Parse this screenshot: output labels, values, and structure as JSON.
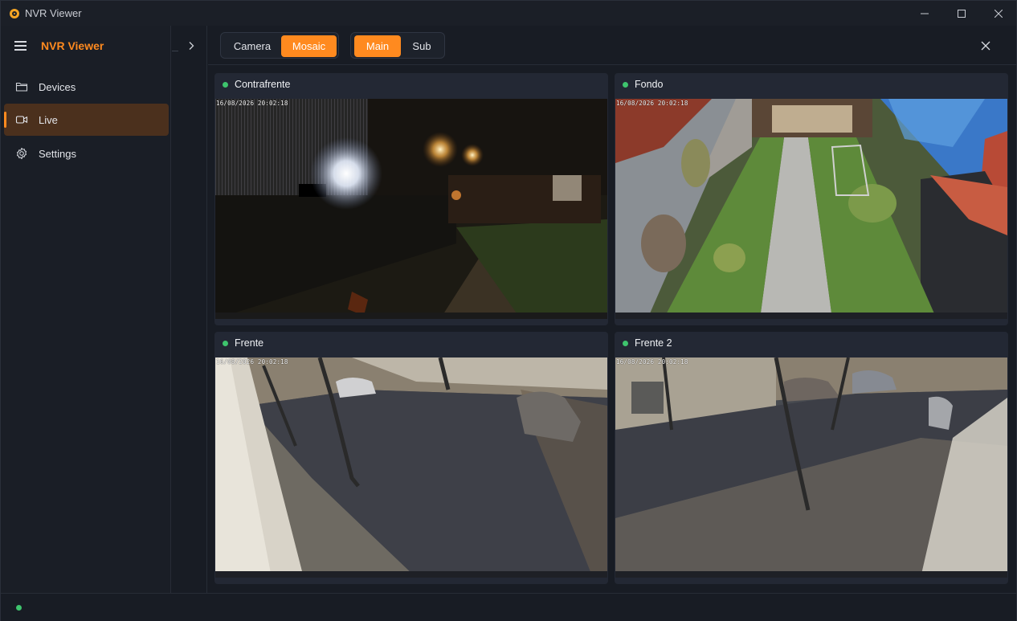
{
  "window": {
    "title": "NVR Viewer"
  },
  "sidebar": {
    "brand": "NVR Viewer",
    "items": [
      {
        "label": "Devices",
        "icon": "folder-icon",
        "active": false
      },
      {
        "label": "Live",
        "icon": "video-camera-icon",
        "active": true
      },
      {
        "label": "Settings",
        "icon": "gear-icon",
        "active": false
      }
    ]
  },
  "toolbar": {
    "view_modes": [
      {
        "label": "Camera",
        "selected": false
      },
      {
        "label": "Mosaic",
        "selected": true
      }
    ],
    "streams": [
      {
        "label": "Main",
        "selected": true
      },
      {
        "label": "Sub",
        "selected": false
      }
    ]
  },
  "cameras": [
    {
      "name": "Contrafrente",
      "status": "online",
      "osd_timestamp": "16/08/2026 20:02:18"
    },
    {
      "name": "Fondo",
      "status": "online",
      "osd_timestamp": "16/08/2026 20:02:18"
    },
    {
      "name": "Frente",
      "status": "online",
      "osd_timestamp": "16/08/2026 20:02:18"
    },
    {
      "name": "Frente 2",
      "status": "online",
      "osd_timestamp": "16/08/2026 20:02:18"
    }
  ],
  "statusbar": {
    "connection": "online"
  },
  "colors": {
    "accent": "#ff8a1f",
    "online": "#3ec46d",
    "active_nav_bg": "#4b301d"
  }
}
